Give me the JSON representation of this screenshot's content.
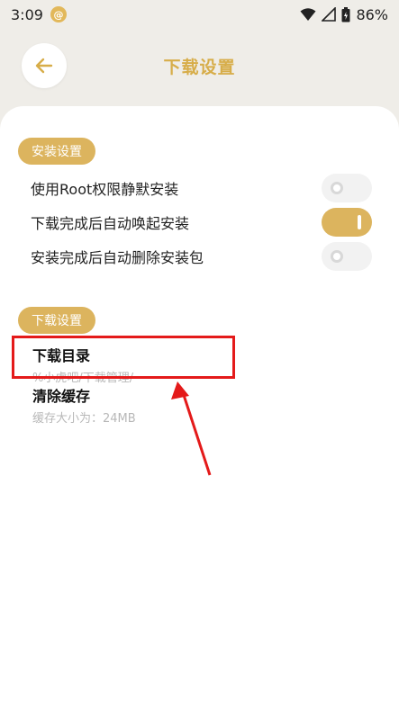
{
  "status_bar": {
    "time": "3:09",
    "app_icon": "@",
    "battery": "86%",
    "icons": [
      "wifi-icon",
      "signal-icon",
      "battery-icon"
    ]
  },
  "header": {
    "title": "下载设置",
    "back_icon": "arrow-left-icon"
  },
  "install_section": {
    "badge": "安装设置",
    "items": [
      {
        "label": "使用Root权限静默安装",
        "enabled": false
      },
      {
        "label": "下载完成后自动唤起安装",
        "enabled": true
      },
      {
        "label": "安装完成后自动删除安装包",
        "enabled": false
      }
    ]
  },
  "download_section": {
    "badge": "下载设置",
    "items": [
      {
        "title": "下载目录",
        "subtitle": "%小虎吧/下载管理/"
      },
      {
        "title": "清除缓存",
        "subtitle": "缓存大小为：24MB"
      }
    ]
  },
  "colors": {
    "accent": "#d7ad49",
    "badge_bg": "#dcb45e",
    "annotation": "#e41a1a"
  }
}
